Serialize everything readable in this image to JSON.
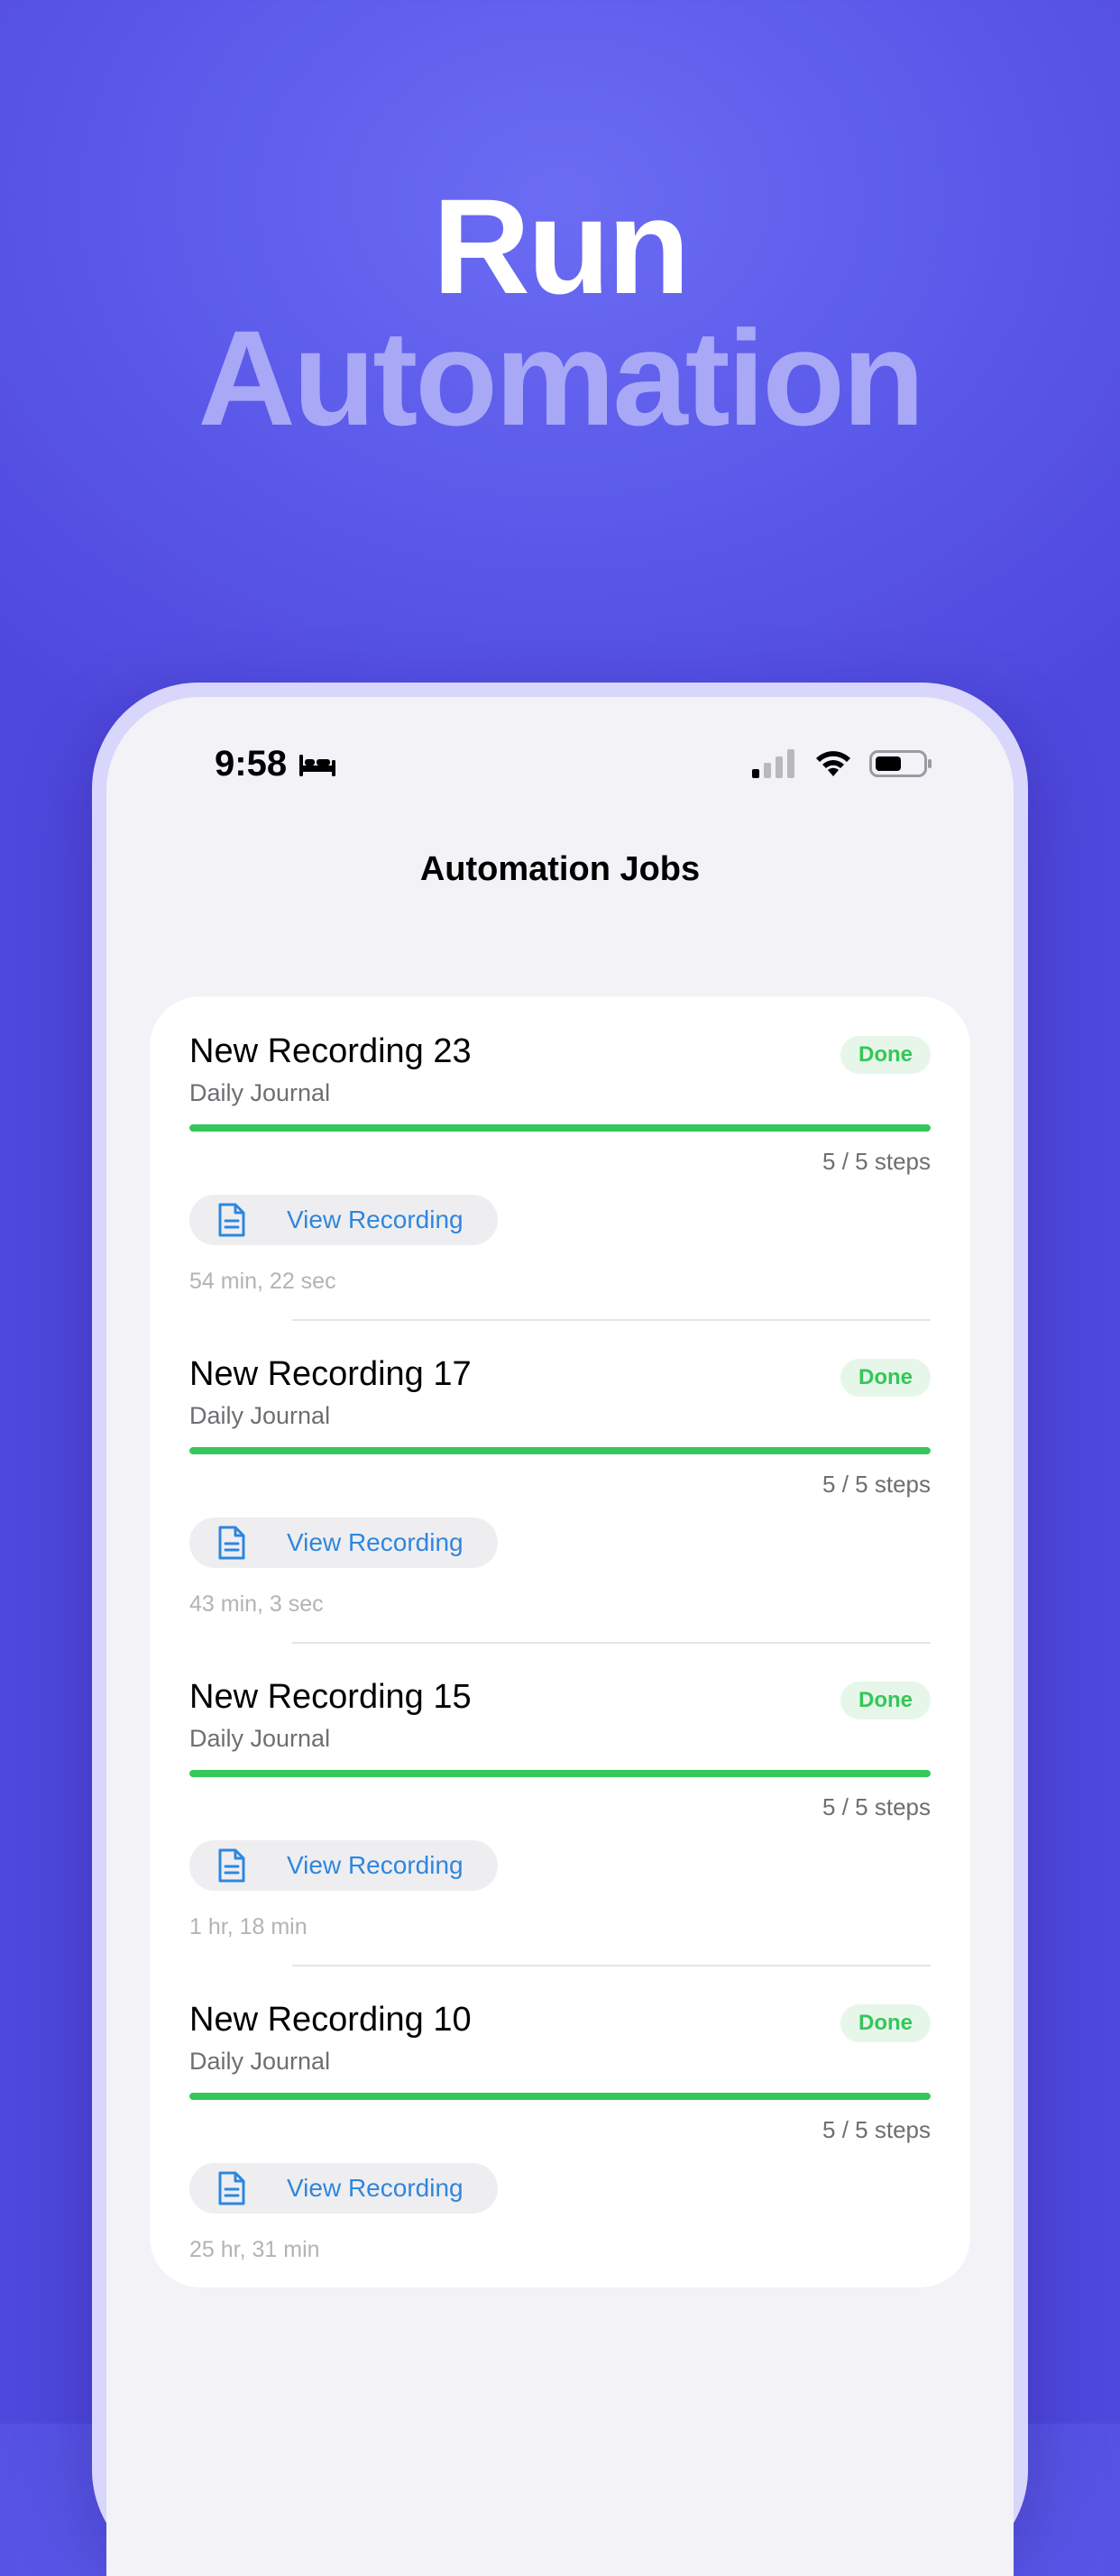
{
  "hero": {
    "line1": "Run",
    "line2": "Automation"
  },
  "status_bar": {
    "time": "9:58",
    "focus_icon": "bed-icon",
    "signal_icon": "cellular-signal-icon",
    "wifi_icon": "wifi-icon",
    "battery_icon": "battery-icon"
  },
  "nav": {
    "title": "Automation Jobs"
  },
  "jobs": [
    {
      "title": "New Recording 23",
      "subtitle": "Daily Journal",
      "status": "Done",
      "steps": "5 / 5 steps",
      "progress": 1.0,
      "button_label": "View Recording",
      "duration": "54 min, 22 sec"
    },
    {
      "title": "New Recording 17",
      "subtitle": "Daily Journal",
      "status": "Done",
      "steps": "5 / 5 steps",
      "progress": 1.0,
      "button_label": "View Recording",
      "duration": "43 min, 3 sec"
    },
    {
      "title": "New Recording 15",
      "subtitle": "Daily Journal",
      "status": "Done",
      "steps": "5 / 5 steps",
      "progress": 1.0,
      "button_label": "View Recording",
      "duration": "1 hr, 18 min"
    },
    {
      "title": "New Recording 10",
      "subtitle": "Daily Journal",
      "status": "Done",
      "steps": "5 / 5 steps",
      "progress": 1.0,
      "button_label": "View Recording",
      "duration": "25 hr, 31 min"
    }
  ],
  "colors": {
    "background": "#5d5ceb",
    "hero_primary": "#ffffff",
    "hero_secondary": "#a9a8f7",
    "done_green": "#34c759",
    "link_blue": "#2f86de"
  }
}
